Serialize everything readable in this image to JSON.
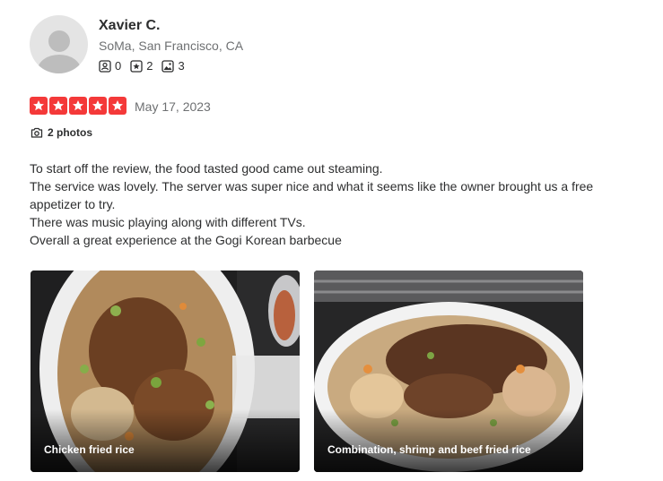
{
  "user": {
    "name": "Xavier C.",
    "location": "SoMa, San Francisco, CA",
    "stats": [
      {
        "icon": "friends-icon",
        "value": "0"
      },
      {
        "icon": "star-review-icon",
        "value": "2"
      },
      {
        "icon": "photo-icon",
        "value": "3"
      }
    ]
  },
  "review": {
    "rating": 5,
    "rating_color": "#f43939",
    "date": "May 17, 2023",
    "photos_label": "2 photos",
    "text": [
      "To start off the review, the food tasted good came out steaming.",
      "The service was lovely. The server was super nice and what it seems like the owner brought us a free appetizer to try.",
      "There was music playing along with different TVs.",
      "Overall a great experience at the Gogi Korean barbecue"
    ]
  },
  "photos": [
    {
      "caption": "Chicken fried rice"
    },
    {
      "caption": "Combination, shrimp and beef fried rice"
    }
  ]
}
